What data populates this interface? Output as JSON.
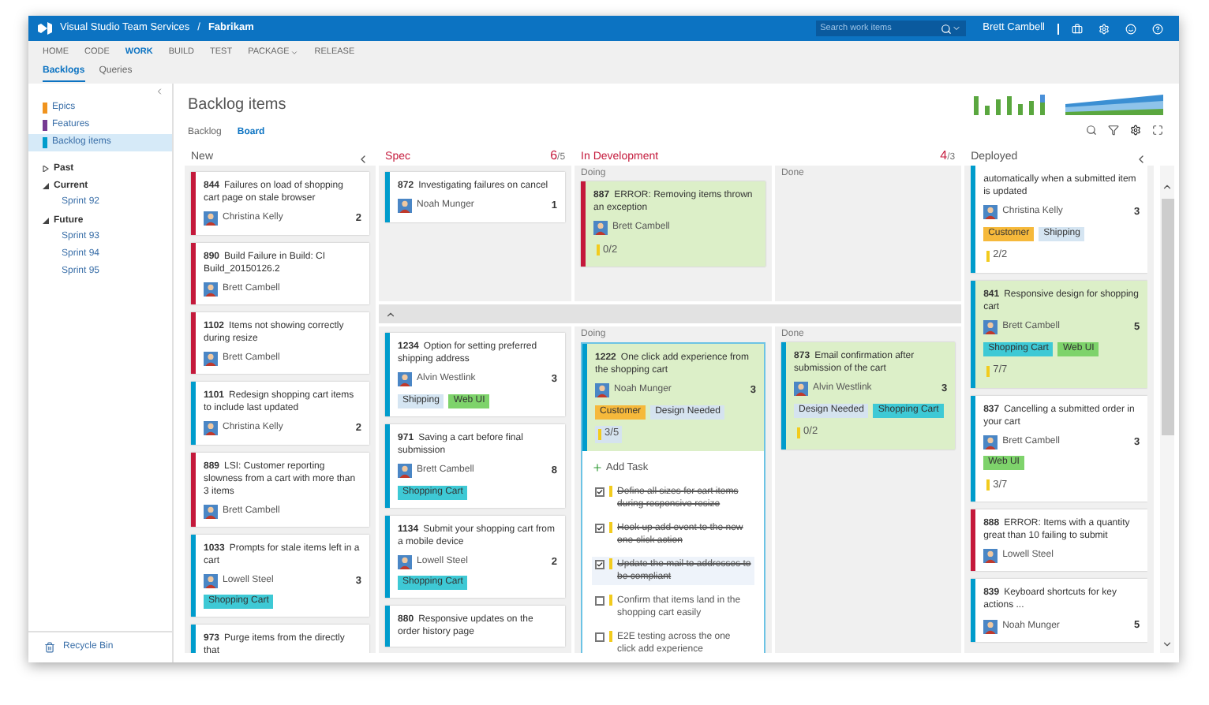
{
  "header": {
    "product": "Visual Studio Team Services",
    "separator": "/",
    "project": "Fabrikam",
    "search": {
      "placeholder": "Search work items"
    },
    "user": "Brett Cambell"
  },
  "nav": [
    {
      "label": "HOME",
      "selected": false,
      "dropdown": false
    },
    {
      "label": "CODE",
      "selected": false,
      "dropdown": false
    },
    {
      "label": "WORK",
      "selected": true,
      "dropdown": false
    },
    {
      "label": "BUILD",
      "selected": false,
      "dropdown": false
    },
    {
      "label": "TEST",
      "selected": false,
      "dropdown": false
    },
    {
      "label": "PACKAGE",
      "selected": false,
      "dropdown": true
    },
    {
      "label": "RELEASE",
      "selected": false,
      "dropdown": false
    }
  ],
  "subnav": [
    {
      "label": "Backlogs",
      "selected": true
    },
    {
      "label": "Queries",
      "selected": false
    }
  ],
  "sidebar": {
    "levels": [
      {
        "label": "Epics",
        "color": "#f0931e",
        "selected": false
      },
      {
        "label": "Features",
        "color": "#773b93",
        "selected": false
      },
      {
        "label": "Backlog items",
        "color": "#009ccc",
        "selected": true
      }
    ],
    "iterations": [
      {
        "label": "Past",
        "expanded": false
      },
      {
        "label": "Current",
        "expanded": true,
        "children": [
          {
            "label": "Sprint 92"
          }
        ]
      },
      {
        "label": "Future",
        "expanded": true,
        "children": [
          {
            "label": "Sprint 93"
          },
          {
            "label": "Sprint 94"
          },
          {
            "label": "Sprint 95"
          }
        ]
      }
    ],
    "recycle_bin": "Recycle Bin"
  },
  "page": {
    "title": "Backlog items",
    "tabs": [
      {
        "label": "Backlog",
        "selected": false
      },
      {
        "label": "Board",
        "selected": true
      }
    ]
  },
  "board": {
    "columns": [
      {
        "title": "New",
        "over_limit": false
      },
      {
        "title": "Spec",
        "over_limit": true,
        "count": "6",
        "limit": "/5"
      },
      {
        "title": "In Development",
        "over_limit": true,
        "count": "4",
        "limit": "/3"
      },
      {
        "title": "Deployed",
        "over_limit": false
      }
    ],
    "new_cards": [
      {
        "id": "844",
        "title": "Failures on load of shopping cart page on stale browser",
        "assignee": "Christina Kelly",
        "effort": "2",
        "color": "#c4193b",
        "highlighted": false
      },
      {
        "id": "890",
        "title": "Build Failure in Build: CI Build_20150126.2",
        "assignee": "Brett Cambell",
        "color": "#c4193b",
        "highlighted": false
      },
      {
        "id": "1102",
        "title": "Items not showing correctly during resize",
        "assignee": "Brett Cambell",
        "color": "#c4193b",
        "highlighted": false
      },
      {
        "id": "1101",
        "title": "Redesign shopping cart items to include last updated",
        "assignee": "Christina Kelly",
        "effort": "2",
        "color": "#009ccc",
        "highlighted": false
      },
      {
        "id": "889",
        "title": "LSI: Customer reporting slowness from a cart with more than 3 items",
        "assignee": "Brett Cambell",
        "color": "#c4193b",
        "highlighted": false
      },
      {
        "id": "1033",
        "title": "Prompts for stale items left in a cart",
        "assignee": "Lowell Steel",
        "effort": "3",
        "color": "#009ccc",
        "highlighted": false,
        "tags": [
          {
            "label": "Shopping Cart",
            "color": "#3ec9d5"
          }
        ]
      },
      {
        "id": "973",
        "title": "Purge items from the directly that",
        "color": "#009ccc",
        "highlighted": false
      }
    ],
    "lanes": [
      {
        "spec_cards": [
          {
            "id": "872",
            "title": "Investigating failures on cancel",
            "assignee": "Noah Munger",
            "effort": "1",
            "color": "#009ccc",
            "highlighted": false
          }
        ],
        "doing_label": "Doing",
        "doing_cards": [
          {
            "id": "887",
            "title": "ERROR: Removing items thrown an exception",
            "assignee": "Brett Cambell",
            "color": "#c4193b",
            "highlighted": true,
            "tasks": "0/2",
            "tasks_expanded": false
          }
        ],
        "done_label": "Done"
      },
      {
        "spec_cards": [
          {
            "id": "1234",
            "title": "Option for setting preferred shipping address",
            "assignee": "Alvin Westlink",
            "effort": "3",
            "color": "#009ccc",
            "highlighted": false,
            "tags": [
              {
                "label": "Shipping",
                "color": "#d5e5f2"
              },
              {
                "label": "Web UI",
                "color": "#7ed36b"
              }
            ]
          },
          {
            "id": "971",
            "title": "Saving a cart before final submission",
            "assignee": "Brett Cambell",
            "effort": "8",
            "color": "#009ccc",
            "highlighted": false,
            "tags": [
              {
                "label": "Shopping Cart",
                "color": "#3ec9d5"
              }
            ]
          },
          {
            "id": "1134",
            "title": "Submit your shopping cart from a mobile device",
            "assignee": "Lowell Steel",
            "effort": "2",
            "color": "#009ccc",
            "highlighted": false,
            "tags": [
              {
                "label": "Shopping Cart",
                "color": "#3ec9d5"
              }
            ]
          },
          {
            "id": "880",
            "title": "Responsive updates on the order history page",
            "color": "#009ccc",
            "highlighted": false
          }
        ],
        "doing_label": "Doing",
        "doing_cards": [
          {
            "id": "1222",
            "title": "One click add experience from the shopping cart",
            "assignee": "Noah Munger",
            "effort": "3",
            "color": "#009ccc",
            "highlighted": true,
            "tags": [
              {
                "label": "Customer",
                "color": "#f6b93b"
              },
              {
                "label": "Design Needed",
                "color": "#d5e3ef"
              }
            ],
            "tasks": "3/5",
            "tasks_expanded": true,
            "add_task": "Add Task",
            "child_tasks": [
              {
                "title": "Define all sizes for cart items during responsive resize",
                "done": true,
                "highlighted": false
              },
              {
                "title": "Hook up add event to the new one-click action",
                "done": true,
                "highlighted": false
              },
              {
                "title": "Update the mail to addresses to be compliant",
                "done": true,
                "highlighted": true
              },
              {
                "title": "Confirm that items land in the shopping cart easily",
                "done": false,
                "highlighted": false
              },
              {
                "title": "E2E testing across the one click add experience",
                "done": false,
                "highlighted": false
              }
            ]
          }
        ],
        "done_label": "Done",
        "done_cards": [
          {
            "id": "873",
            "title": "Email confirmation after submission of the cart",
            "assignee": "Alvin Westlink",
            "effort": "3",
            "color": "#009ccc",
            "highlighted": true,
            "tags": [
              {
                "label": "Design Needed",
                "color": "#d5e3ef"
              },
              {
                "label": "Shopping Cart",
                "color": "#3ec9d5"
              }
            ],
            "tasks": "0/2",
            "tasks_expanded": false
          }
        ]
      }
    ],
    "deployed_cards": [
      {
        "title": "automatically when a submitted item is updated",
        "assignee": "Christina Kelly",
        "effort": "3",
        "color": "#009ccc",
        "highlighted": false,
        "tags": [
          {
            "label": "Customer",
            "color": "#f6b93b"
          },
          {
            "label": "Shipping",
            "color": "#d5e5f2"
          }
        ],
        "tasks": "2/2",
        "tasks_expanded": false
      },
      {
        "id": "841",
        "title": "Responsive design for shopping cart",
        "assignee": "Brett Cambell",
        "effort": "5",
        "color": "#009ccc",
        "highlighted": true,
        "tags": [
          {
            "label": "Shopping Cart",
            "color": "#3ec9d5"
          },
          {
            "label": "Web UI",
            "color": "#7ed36b"
          }
        ],
        "tasks": "7/7",
        "tasks_expanded": false
      },
      {
        "id": "837",
        "title": "Cancelling a submitted order in your cart",
        "assignee": "Brett Cambell",
        "effort": "3",
        "color": "#009ccc",
        "highlighted": false,
        "tags": [
          {
            "label": "Web UI",
            "color": "#7ed36b"
          }
        ],
        "tasks": "3/7",
        "tasks_expanded": false
      },
      {
        "id": "888",
        "title": "ERROR: Items with a quantity great than 10 failing to submit",
        "assignee": "Lowell Steel",
        "color": "#c4193b",
        "highlighted": false
      },
      {
        "id": "839",
        "title": "Keyboard shortcuts for key actions ...",
        "assignee": "Noah Munger",
        "effort": "5",
        "color": "#009ccc",
        "highlighted": false
      }
    ]
  }
}
